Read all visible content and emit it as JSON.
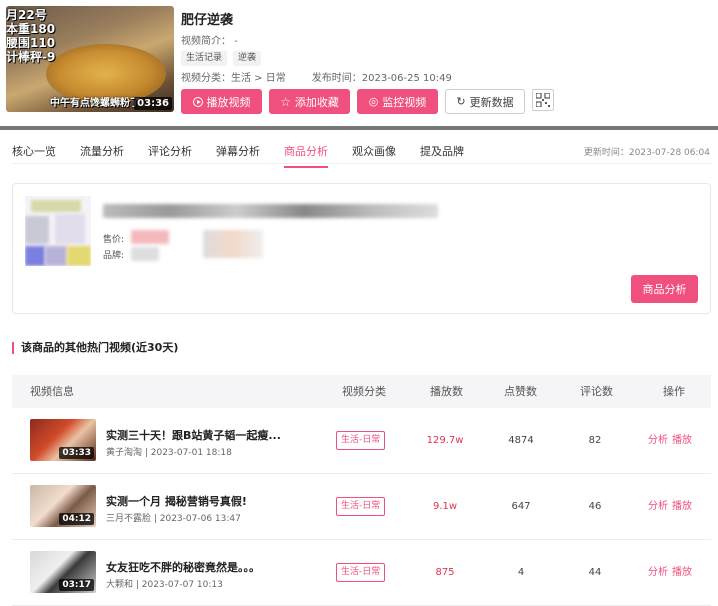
{
  "video": {
    "thumb_stats": "月22号\n本重180\n腰围110\n计棒秤-9",
    "thumb_caption": "中午有点馋螺蛳粉了",
    "duration": "03:36",
    "title": "肥仔逆袭",
    "desc": "视频简介： -",
    "tags": [
      "生活记录",
      "逆袭"
    ],
    "category": "视频分类：生活 > 日常",
    "publish": "发布时间：2023-06-25 10:49"
  },
  "actions": {
    "play": "播放视频",
    "favorite": "添加收藏",
    "monitor": "监控视频",
    "refresh": "更新数据"
  },
  "tabs": [
    "核心一览",
    "流量分析",
    "评论分析",
    "弹幕分析",
    "商品分析",
    "观众画像",
    "提及品牌"
  ],
  "active_tab": 4,
  "updated": "更新时间：2023-07-28 06:04",
  "product": {
    "price_label": "售价:",
    "brand_label": "品牌:",
    "analyze_button": "商品分析"
  },
  "section_title": "该商品的其他热门视频(近30天)",
  "table": {
    "headers": [
      "视频信息",
      "视频分类",
      "播放数",
      "点赞数",
      "评论数",
      "操作"
    ],
    "rows": [
      {
        "title": "实测三十天！跟B站黄子韬一起瘦...",
        "meta": "黄子淘淘 | 2023-07-01 18:18",
        "duration": "03:33",
        "category": "生活-日常",
        "plays": "129.7w",
        "likes": "4874",
        "comments": "82"
      },
      {
        "title": "实测一个月 揭秘营销号真假!",
        "meta": "三月不露脸 | 2023-07-06 13:47",
        "duration": "04:12",
        "category": "生活-日常",
        "plays": "9.1w",
        "likes": "647",
        "comments": "46"
      },
      {
        "title": "女友狂吃不胖的秘密竟然是。。。",
        "meta": "大颗和 | 2023-07-07 10:13",
        "duration": "03:17",
        "category": "生活-日常",
        "plays": "875",
        "likes": "4",
        "comments": "44"
      }
    ],
    "op_analyze": "分析",
    "op_play": "播放"
  },
  "colors": {
    "accent": "#f0507d",
    "hot": "#e3324f"
  }
}
